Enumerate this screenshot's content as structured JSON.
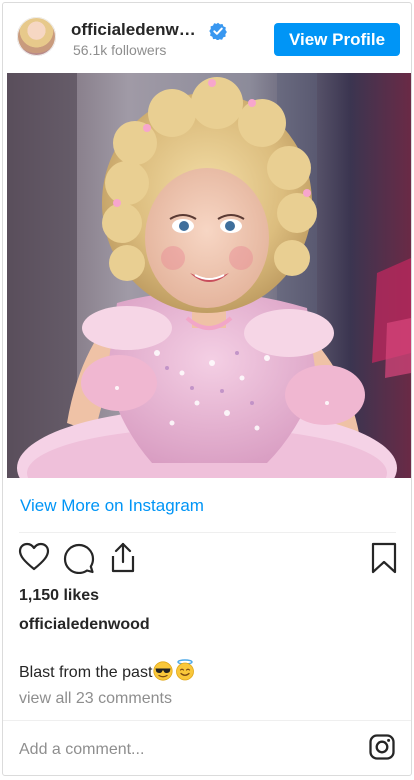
{
  "post": {
    "username": "officialedenwood",
    "followers": "56.1k followers",
    "view_profile_label": "View Profile",
    "view_more_label": "View More on Instagram",
    "likes": "1,150 likes",
    "caption_user": "officialedenwood",
    "caption_text": "Blast from the past",
    "caption_emojis": [
      "sunglasses-face",
      "smiling-face-with-halo"
    ],
    "comments_link": "view all 23 comments",
    "add_comment_placeholder": "Add a comment..."
  },
  "icons": [
    "verified-badge-icon",
    "heart-icon",
    "comment-icon",
    "share-icon",
    "bookmark-icon",
    "instagram-icon"
  ],
  "colors": {
    "accent": "#0095f6",
    "text": "#262626",
    "muted": "#8e8e8e",
    "border": "#dbdbdb"
  }
}
